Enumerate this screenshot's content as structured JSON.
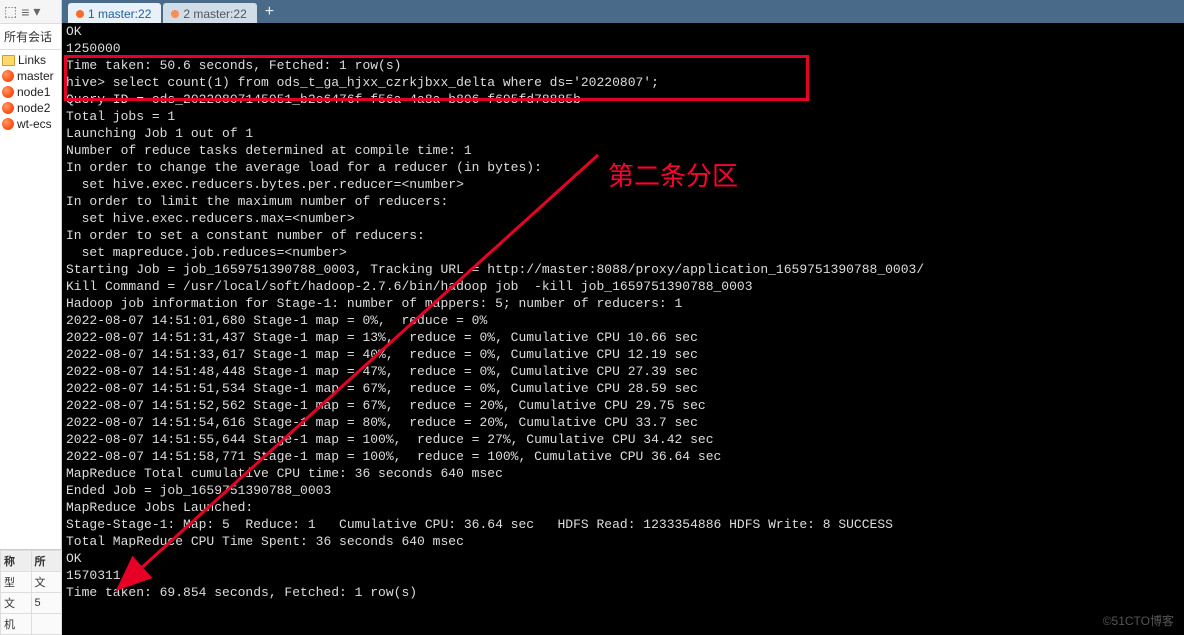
{
  "toolbar": {
    "icon1": "⬚",
    "icon2": "≡",
    "icon3": "▾"
  },
  "sidebar": {
    "sessions_label": "所有会话",
    "items": [
      {
        "label": "Links",
        "type": "folder"
      },
      {
        "label": "master",
        "type": "xshell"
      },
      {
        "label": "node1",
        "type": "xshell"
      },
      {
        "label": "node2",
        "type": "xshell"
      },
      {
        "label": "wt-ecs",
        "type": "xshell"
      }
    ]
  },
  "bottom_grid": {
    "headers": [
      "称",
      "所"
    ],
    "rows": [
      [
        "型",
        "文"
      ],
      [
        "文",
        "5"
      ],
      [
        "机",
        ""
      ]
    ]
  },
  "tabs": {
    "active": {
      "label": "1 master:22"
    },
    "inactive": {
      "label": "2 master:22"
    },
    "plus": "+"
  },
  "terminal": {
    "lines": [
      "OK",
      "1250000",
      "Time taken: 50.6 seconds, Fetched: 1 row(s)",
      "hive> select count(1) from ods_t_ga_hjxx_czrkjbxx_delta where ds='20220807';",
      "Query ID = ods_20220807145051_b2e6476f-f56a-4a8a-b806-f695fd78885b",
      "Total jobs = 1",
      "Launching Job 1 out of 1",
      "Number of reduce tasks determined at compile time: 1",
      "In order to change the average load for a reducer (in bytes):",
      "  set hive.exec.reducers.bytes.per.reducer=<number>",
      "In order to limit the maximum number of reducers:",
      "  set hive.exec.reducers.max=<number>",
      "In order to set a constant number of reducers:",
      "  set mapreduce.job.reduces=<number>",
      "Starting Job = job_1659751390788_0003, Tracking URL = http://master:8088/proxy/application_1659751390788_0003/",
      "Kill Command = /usr/local/soft/hadoop-2.7.6/bin/hadoop job  -kill job_1659751390788_0003",
      "Hadoop job information for Stage-1: number of mappers: 5; number of reducers: 1",
      "2022-08-07 14:51:01,680 Stage-1 map = 0%,  reduce = 0%",
      "2022-08-07 14:51:31,437 Stage-1 map = 13%,  reduce = 0%, Cumulative CPU 10.66 sec",
      "2022-08-07 14:51:33,617 Stage-1 map = 40%,  reduce = 0%, Cumulative CPU 12.19 sec",
      "2022-08-07 14:51:48,448 Stage-1 map = 47%,  reduce = 0%, Cumulative CPU 27.39 sec",
      "2022-08-07 14:51:51,534 Stage-1 map = 67%,  reduce = 0%, Cumulative CPU 28.59 sec",
      "2022-08-07 14:51:52,562 Stage-1 map = 67%,  reduce = 20%, Cumulative CPU 29.75 sec",
      "2022-08-07 14:51:54,616 Stage-1 map = 80%,  reduce = 20%, Cumulative CPU 33.7 sec",
      "2022-08-07 14:51:55,644 Stage-1 map = 100%,  reduce = 27%, Cumulative CPU 34.42 sec",
      "2022-08-07 14:51:58,771 Stage-1 map = 100%,  reduce = 100%, Cumulative CPU 36.64 sec",
      "MapReduce Total cumulative CPU time: 36 seconds 640 msec",
      "Ended Job = job_1659751390788_0003",
      "MapReduce Jobs Launched:",
      "Stage-Stage-1: Map: 5  Reduce: 1   Cumulative CPU: 36.64 sec   HDFS Read: 1233354886 HDFS Write: 8 SUCCESS",
      "Total MapReduce CPU Time Spent: 36 seconds 640 msec",
      "OK",
      "1570311",
      "Time taken: 69.854 seconds, Fetched: 1 row(s)"
    ]
  },
  "annotations": {
    "label": "第二条分区"
  },
  "watermark": "©51CTO博客"
}
